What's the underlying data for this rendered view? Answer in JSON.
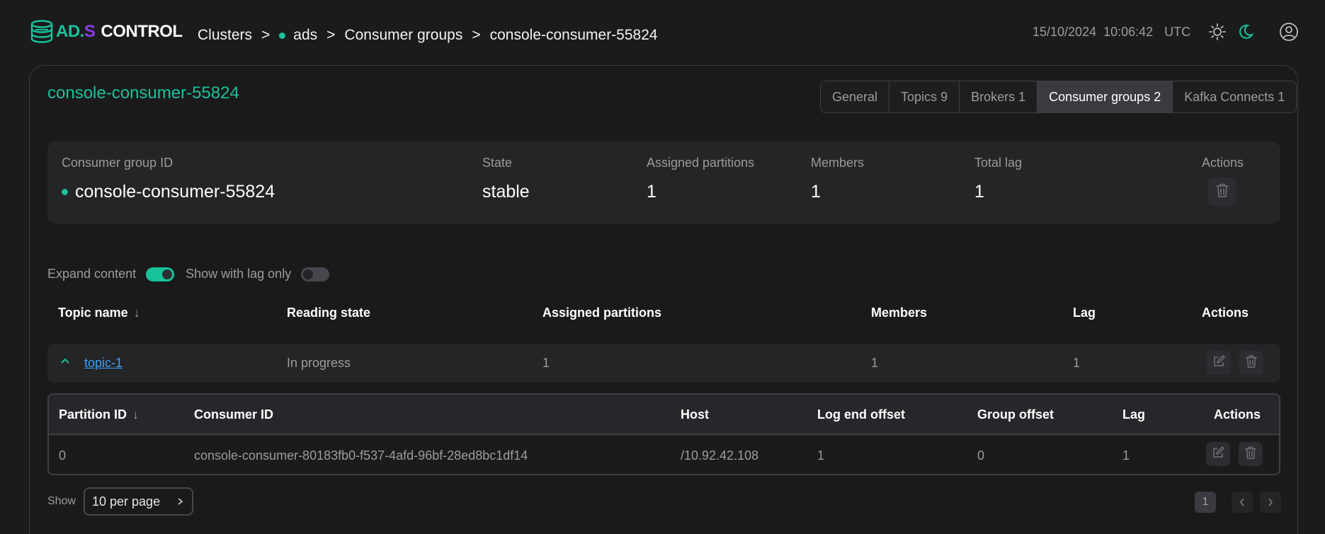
{
  "brand": {
    "ad": "AD",
    "dot": ".",
    "s": "S",
    "control": "CONTROL"
  },
  "breadcrumb": {
    "clusters": "Clusters",
    "sep": ">",
    "cluster": "ads",
    "section": "Consumer groups",
    "current": "console-consumer-55824"
  },
  "clock": {
    "date": "15/10/2024",
    "time": "10:06:42",
    "tz": "UTC"
  },
  "page": {
    "title": "console-consumer-55824"
  },
  "tabs": [
    {
      "label": "General",
      "active": false
    },
    {
      "label": "Topics 9",
      "active": false
    },
    {
      "label": "Brokers 1",
      "active": false
    },
    {
      "label": "Consumer groups 2",
      "active": true
    },
    {
      "label": "Kafka Connects 1",
      "active": false
    }
  ],
  "summary": {
    "group_id_label": "Consumer group ID",
    "group_id": "console-consumer-55824",
    "state_label": "State",
    "state": "stable",
    "assigned_label": "Assigned partitions",
    "assigned": "1",
    "members_label": "Members",
    "members": "1",
    "lag_label": "Total lag",
    "lag": "1",
    "actions_label": "Actions"
  },
  "filters": {
    "expand_label": "Expand content",
    "expand_on": true,
    "lag_only_label": "Show with lag only",
    "lag_only_on": false
  },
  "topic_table": {
    "headers": {
      "topic": "Topic name",
      "reading": "Reading state",
      "assigned": "Assigned partitions",
      "members": "Members",
      "lag": "Lag",
      "actions": "Actions"
    },
    "rows": [
      {
        "topic": "topic-1",
        "reading": "In progress",
        "assigned": "1",
        "members": "1",
        "lag": "1"
      }
    ]
  },
  "partition_table": {
    "headers": {
      "partition": "Partition ID",
      "consumer": "Consumer ID",
      "host": "Host",
      "log_end": "Log end offset",
      "group_offset": "Group offset",
      "lag": "Lag",
      "actions": "Actions"
    },
    "rows": [
      {
        "partition": "0",
        "consumer": "console-consumer-80183fb0-f537-4afd-96bf-28ed8bc1df14",
        "host": "/10.92.42.108",
        "log_end": "1",
        "group_offset": "0",
        "lag": "1"
      }
    ]
  },
  "pagination": {
    "show_label": "Show",
    "per_page": "10 per page",
    "current_page": "1"
  },
  "colors": {
    "accent": "#17c29a",
    "brand_purple": "#8a3ce8",
    "link": "#3aa0ff",
    "background": "#1b1b1c"
  },
  "icons": [
    "db-stack-icon",
    "sun-icon",
    "moon-icon",
    "user-circle-icon",
    "trash-icon",
    "edit-icon",
    "chevron-up-icon",
    "chevron-right-icon",
    "chevron-left-icon",
    "sort-down-icon"
  ]
}
